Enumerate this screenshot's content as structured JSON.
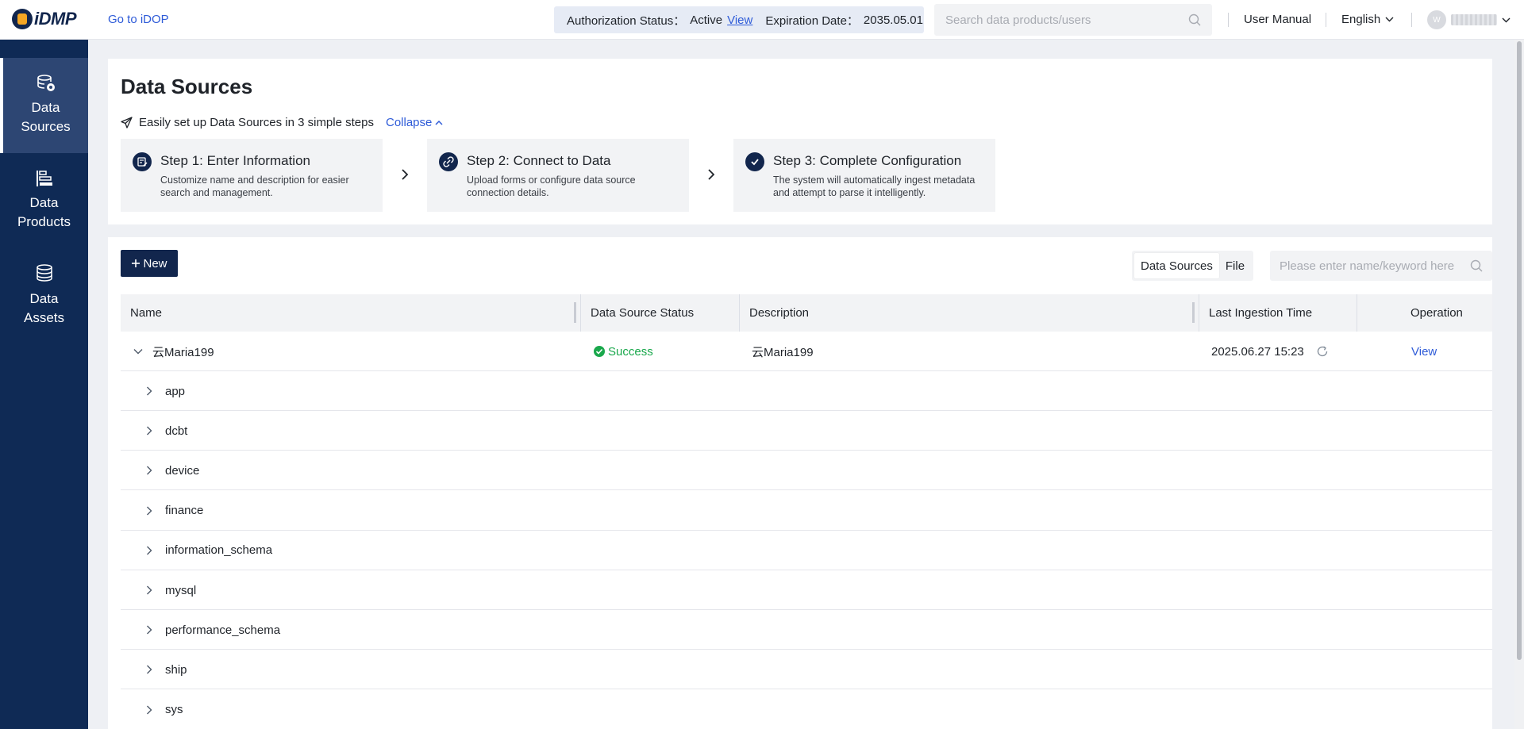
{
  "header": {
    "logo_text": "iDMP",
    "goto_link": "Go to iDOP",
    "auth_label": "Authorization Status：",
    "auth_value": "Active",
    "auth_view": "View",
    "expiry_label": "Expiration Date：",
    "expiry_value": "2035.05.01",
    "search_placeholder": "Search data products/users",
    "user_manual": "User Manual",
    "language": "English",
    "avatar_initial": "W"
  },
  "sidebar": {
    "items": [
      {
        "line1": "Data",
        "line2": "Sources",
        "icon": "database-icon",
        "active": true
      },
      {
        "line1": "Data",
        "line2": "Products",
        "icon": "hierarchy-icon",
        "active": false
      },
      {
        "line1": "Data",
        "line2": "Assets",
        "icon": "yen-stack-icon",
        "active": false
      }
    ]
  },
  "main": {
    "title": "Data Sources",
    "steps_hint": "Easily set up Data Sources in 3 simple steps",
    "collapse": "Collapse",
    "steps": [
      {
        "title": "Step 1: Enter Information",
        "desc": "Customize name and description for easier search and management."
      },
      {
        "title": "Step 2: Connect to Data",
        "desc": "Upload forms or configure data source connection details."
      },
      {
        "title": "Step 3: Complete Configuration",
        "desc": "The system will automatically ingest metadata and attempt to parse it intelligently."
      }
    ],
    "new_button": "New",
    "toggle": {
      "options": [
        "Data Sources",
        "File"
      ],
      "selected": "Data Sources"
    },
    "table_search_placeholder": "Please enter name/keyword here"
  },
  "table": {
    "columns": [
      "Name",
      "Data Source Status",
      "Description",
      "Last Ingestion Time",
      "Operation"
    ],
    "parent": {
      "name": "云Maria199",
      "status": "Success",
      "description": "云Maria199",
      "last_ingestion": "2025.06.27 15:23",
      "operation": "View"
    },
    "children": [
      "app",
      "dcbt",
      "device",
      "finance",
      "information_schema",
      "mysql",
      "performance_schema",
      "ship",
      "sys"
    ]
  }
}
